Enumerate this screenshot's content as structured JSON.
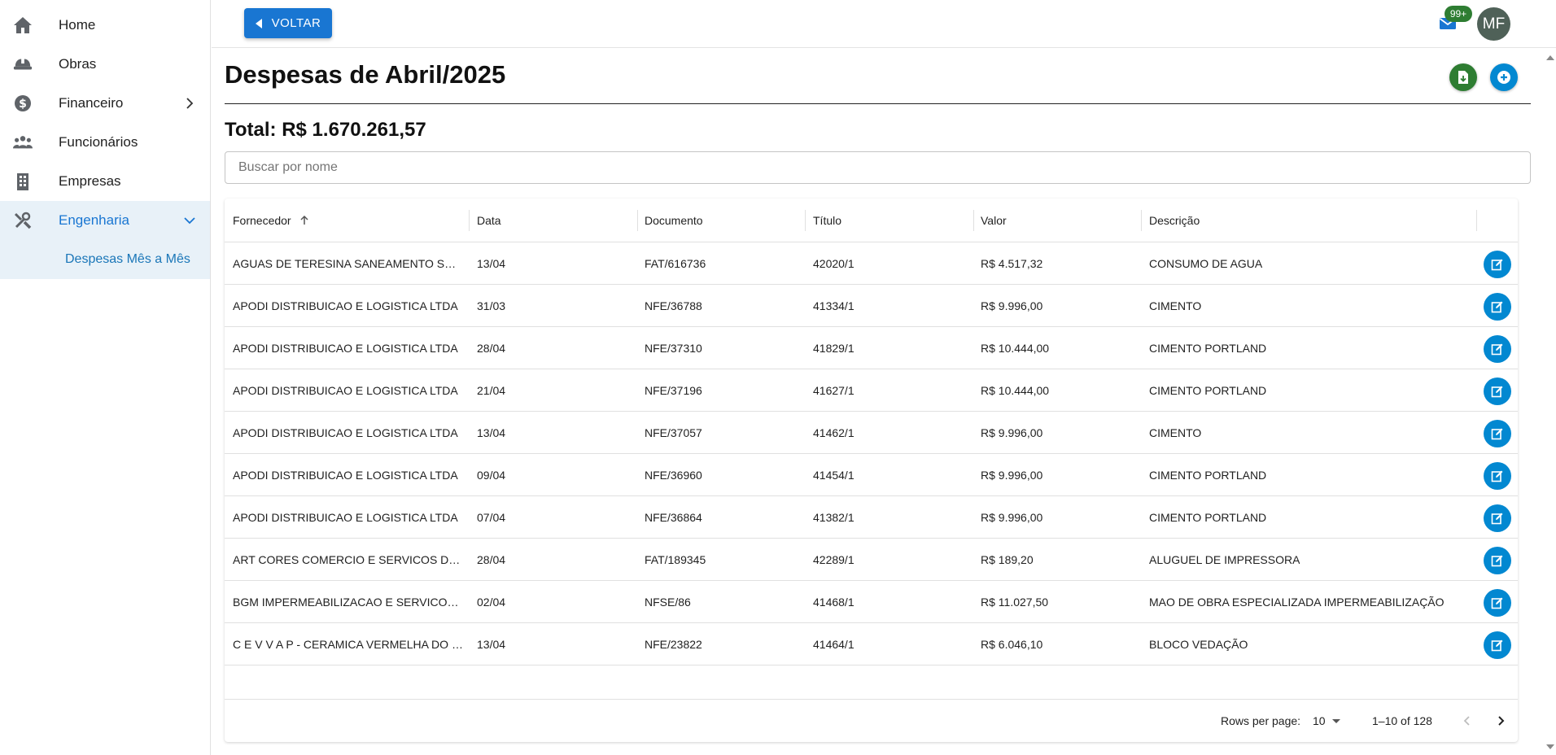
{
  "sidebar": {
    "items": [
      {
        "label": "Home",
        "icon": "home-icon"
      },
      {
        "label": "Obras",
        "icon": "hard-hat-icon"
      },
      {
        "label": "Financeiro",
        "icon": "dollar-circle-icon"
      },
      {
        "label": "Funcionários",
        "icon": "people-icon"
      },
      {
        "label": "Empresas",
        "icon": "building-icon"
      },
      {
        "label": "Engenharia",
        "icon": "tools-icon"
      }
    ],
    "sub_item": {
      "label": "Despesas Mês a Mês"
    }
  },
  "topbar": {
    "back_label": "VOLTAR",
    "notifications_badge": "99+",
    "avatar_initials": "MF"
  },
  "main": {
    "title": "Despesas de Abril/2025",
    "total": "Total: R$ 1.670.261,57",
    "search_placeholder": "Buscar por nome"
  },
  "table": {
    "columns": [
      "Fornecedor",
      "Data",
      "Documento",
      "Título",
      "Valor",
      "Descrição"
    ],
    "rows": [
      [
        "AGUAS DE TERESINA SANEAMENTO SPE S...",
        "13/04",
        "FAT/616736",
        "42020/1",
        "R$ 4.517,32",
        "CONSUMO DE AGUA"
      ],
      [
        "APODI DISTRIBUICAO E LOGISTICA LTDA",
        "31/03",
        "NFE/36788",
        "41334/1",
        "R$ 9.996,00",
        "CIMENTO"
      ],
      [
        "APODI DISTRIBUICAO E LOGISTICA LTDA",
        "28/04",
        "NFE/37310",
        "41829/1",
        "R$ 10.444,00",
        "CIMENTO PORTLAND"
      ],
      [
        "APODI DISTRIBUICAO E LOGISTICA LTDA",
        "21/04",
        "NFE/37196",
        "41627/1",
        "R$ 10.444,00",
        "CIMENTO PORTLAND"
      ],
      [
        "APODI DISTRIBUICAO E LOGISTICA LTDA",
        "13/04",
        "NFE/37057",
        "41462/1",
        "R$ 9.996,00",
        "CIMENTO"
      ],
      [
        "APODI DISTRIBUICAO E LOGISTICA LTDA",
        "09/04",
        "NFE/36960",
        "41454/1",
        "R$ 9.996,00",
        "CIMENTO PORTLAND"
      ],
      [
        "APODI DISTRIBUICAO E LOGISTICA LTDA",
        "07/04",
        "NFE/36864",
        "41382/1",
        "R$ 9.996,00",
        "CIMENTO PORTLAND"
      ],
      [
        "ART CORES COMERCIO E SERVICOS DE IN...",
        "28/04",
        "FAT/189345",
        "42289/1",
        "R$ 189,20",
        "ALUGUEL DE IMPRESSORA"
      ],
      [
        "BGM IMPERMEABILIZACAO E SERVICOS L...",
        "02/04",
        "NFSE/86",
        "41468/1",
        "R$ 11.027,50",
        "MAO DE OBRA ESPECIALIZADA IMPERMEABILIZAÇÃO"
      ],
      [
        "C E V V A P - CERAMICA VERMELHA DO VA...",
        "13/04",
        "NFE/23822",
        "41464/1",
        "R$ 6.046,10",
        "BLOCO VEDAÇÃO"
      ]
    ]
  },
  "pagination": {
    "rows_per_page_label": "Rows per page:",
    "rows_per_page_value": "10",
    "range": "1–10 of 128"
  },
  "colors": {
    "primary": "#1976d2",
    "accent_blue": "#0288d1",
    "green": "#2e7d32",
    "active_nav_bg": "#e8f1f8"
  }
}
